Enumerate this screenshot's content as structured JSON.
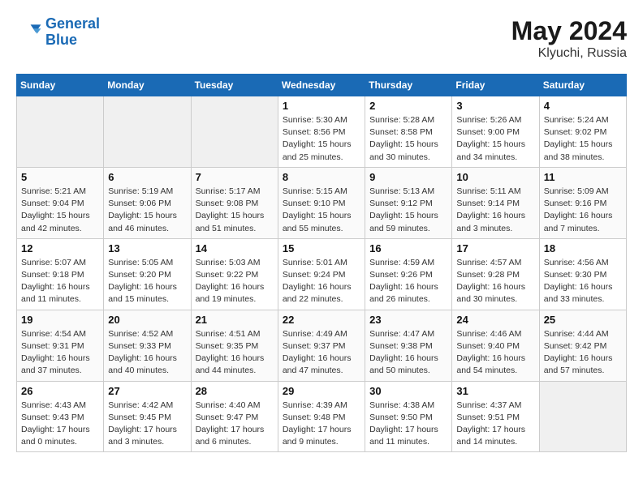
{
  "header": {
    "logo_line1": "General",
    "logo_line2": "Blue",
    "month_year": "May 2024",
    "location": "Klyuchi, Russia"
  },
  "weekdays": [
    "Sunday",
    "Monday",
    "Tuesday",
    "Wednesday",
    "Thursday",
    "Friday",
    "Saturday"
  ],
  "weeks": [
    [
      {
        "day": "",
        "info": ""
      },
      {
        "day": "",
        "info": ""
      },
      {
        "day": "",
        "info": ""
      },
      {
        "day": "1",
        "info": "Sunrise: 5:30 AM\nSunset: 8:56 PM\nDaylight: 15 hours\nand 25 minutes."
      },
      {
        "day": "2",
        "info": "Sunrise: 5:28 AM\nSunset: 8:58 PM\nDaylight: 15 hours\nand 30 minutes."
      },
      {
        "day": "3",
        "info": "Sunrise: 5:26 AM\nSunset: 9:00 PM\nDaylight: 15 hours\nand 34 minutes."
      },
      {
        "day": "4",
        "info": "Sunrise: 5:24 AM\nSunset: 9:02 PM\nDaylight: 15 hours\nand 38 minutes."
      }
    ],
    [
      {
        "day": "5",
        "info": "Sunrise: 5:21 AM\nSunset: 9:04 PM\nDaylight: 15 hours\nand 42 minutes."
      },
      {
        "day": "6",
        "info": "Sunrise: 5:19 AM\nSunset: 9:06 PM\nDaylight: 15 hours\nand 46 minutes."
      },
      {
        "day": "7",
        "info": "Sunrise: 5:17 AM\nSunset: 9:08 PM\nDaylight: 15 hours\nand 51 minutes."
      },
      {
        "day": "8",
        "info": "Sunrise: 5:15 AM\nSunset: 9:10 PM\nDaylight: 15 hours\nand 55 minutes."
      },
      {
        "day": "9",
        "info": "Sunrise: 5:13 AM\nSunset: 9:12 PM\nDaylight: 15 hours\nand 59 minutes."
      },
      {
        "day": "10",
        "info": "Sunrise: 5:11 AM\nSunset: 9:14 PM\nDaylight: 16 hours\nand 3 minutes."
      },
      {
        "day": "11",
        "info": "Sunrise: 5:09 AM\nSunset: 9:16 PM\nDaylight: 16 hours\nand 7 minutes."
      }
    ],
    [
      {
        "day": "12",
        "info": "Sunrise: 5:07 AM\nSunset: 9:18 PM\nDaylight: 16 hours\nand 11 minutes."
      },
      {
        "day": "13",
        "info": "Sunrise: 5:05 AM\nSunset: 9:20 PM\nDaylight: 16 hours\nand 15 minutes."
      },
      {
        "day": "14",
        "info": "Sunrise: 5:03 AM\nSunset: 9:22 PM\nDaylight: 16 hours\nand 19 minutes."
      },
      {
        "day": "15",
        "info": "Sunrise: 5:01 AM\nSunset: 9:24 PM\nDaylight: 16 hours\nand 22 minutes."
      },
      {
        "day": "16",
        "info": "Sunrise: 4:59 AM\nSunset: 9:26 PM\nDaylight: 16 hours\nand 26 minutes."
      },
      {
        "day": "17",
        "info": "Sunrise: 4:57 AM\nSunset: 9:28 PM\nDaylight: 16 hours\nand 30 minutes."
      },
      {
        "day": "18",
        "info": "Sunrise: 4:56 AM\nSunset: 9:30 PM\nDaylight: 16 hours\nand 33 minutes."
      }
    ],
    [
      {
        "day": "19",
        "info": "Sunrise: 4:54 AM\nSunset: 9:31 PM\nDaylight: 16 hours\nand 37 minutes."
      },
      {
        "day": "20",
        "info": "Sunrise: 4:52 AM\nSunset: 9:33 PM\nDaylight: 16 hours\nand 40 minutes."
      },
      {
        "day": "21",
        "info": "Sunrise: 4:51 AM\nSunset: 9:35 PM\nDaylight: 16 hours\nand 44 minutes."
      },
      {
        "day": "22",
        "info": "Sunrise: 4:49 AM\nSunset: 9:37 PM\nDaylight: 16 hours\nand 47 minutes."
      },
      {
        "day": "23",
        "info": "Sunrise: 4:47 AM\nSunset: 9:38 PM\nDaylight: 16 hours\nand 50 minutes."
      },
      {
        "day": "24",
        "info": "Sunrise: 4:46 AM\nSunset: 9:40 PM\nDaylight: 16 hours\nand 54 minutes."
      },
      {
        "day": "25",
        "info": "Sunrise: 4:44 AM\nSunset: 9:42 PM\nDaylight: 16 hours\nand 57 minutes."
      }
    ],
    [
      {
        "day": "26",
        "info": "Sunrise: 4:43 AM\nSunset: 9:43 PM\nDaylight: 17 hours\nand 0 minutes."
      },
      {
        "day": "27",
        "info": "Sunrise: 4:42 AM\nSunset: 9:45 PM\nDaylight: 17 hours\nand 3 minutes."
      },
      {
        "day": "28",
        "info": "Sunrise: 4:40 AM\nSunset: 9:47 PM\nDaylight: 17 hours\nand 6 minutes."
      },
      {
        "day": "29",
        "info": "Sunrise: 4:39 AM\nSunset: 9:48 PM\nDaylight: 17 hours\nand 9 minutes."
      },
      {
        "day": "30",
        "info": "Sunrise: 4:38 AM\nSunset: 9:50 PM\nDaylight: 17 hours\nand 11 minutes."
      },
      {
        "day": "31",
        "info": "Sunrise: 4:37 AM\nSunset: 9:51 PM\nDaylight: 17 hours\nand 14 minutes."
      },
      {
        "day": "",
        "info": ""
      }
    ]
  ]
}
